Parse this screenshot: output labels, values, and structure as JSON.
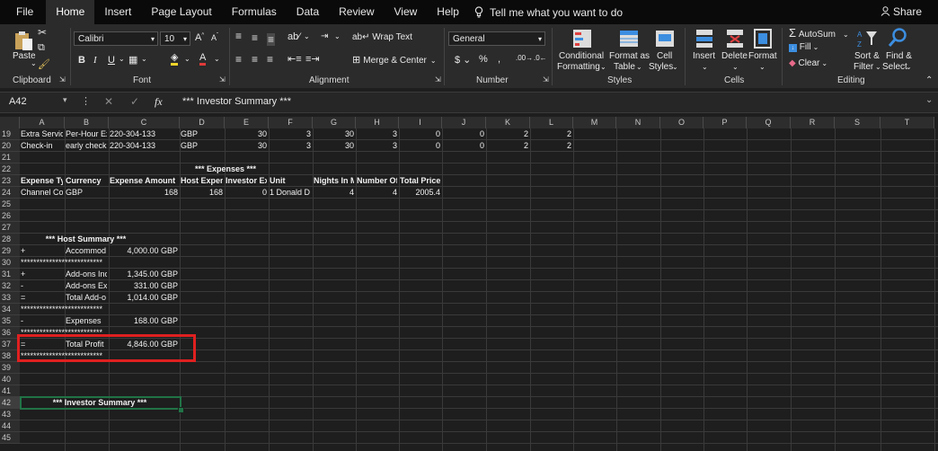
{
  "menu": {
    "file": "File",
    "home": "Home",
    "insert": "Insert",
    "page_layout": "Page Layout",
    "formulas": "Formulas",
    "data": "Data",
    "review": "Review",
    "view": "View",
    "help": "Help",
    "tell_me": "Tell me what you want to do",
    "share": "Share"
  },
  "ribbon": {
    "paste": "Paste",
    "clipboard": "Clipboard",
    "font_name": "Calibri",
    "font_size": "10",
    "font": "Font",
    "wrap_text": "Wrap Text",
    "merge_center": "Merge & Center",
    "alignment": "Alignment",
    "number_format": "General",
    "number": "Number",
    "conditional_formatting_1": "Conditional",
    "conditional_formatting_2": "Formatting",
    "format_as_table_1": "Format as",
    "format_as_table_2": "Table",
    "cell_styles_1": "Cell",
    "cell_styles_2": "Styles",
    "styles": "Styles",
    "insert": "Insert",
    "delete": "Delete",
    "format": "Format",
    "cells": "Cells",
    "autosum": "AutoSum",
    "fill": "Fill",
    "clear": "Clear",
    "sort_filter_1": "Sort &",
    "sort_filter_2": "Filter",
    "find_select_1": "Find &",
    "find_select_2": "Select",
    "editing": "Editing"
  },
  "formula_bar": {
    "name_box": "A42",
    "formula": "*** Investor Summary ***"
  },
  "columns": [
    "A",
    "B",
    "C",
    "D",
    "E",
    "F",
    "G",
    "H",
    "I",
    "J",
    "K",
    "L",
    "M",
    "N",
    "O",
    "P",
    "Q",
    "R",
    "S",
    "T"
  ],
  "rows": [
    "19",
    "20",
    "21",
    "22",
    "23",
    "24",
    "25",
    "26",
    "27",
    "28",
    "29",
    "30",
    "31",
    "32",
    "33",
    "34",
    "35",
    "36",
    "37",
    "38",
    "39",
    "40",
    "41",
    "42",
    "43",
    "44",
    "45"
  ],
  "selected_row": "42",
  "cells": {
    "r19": {
      "a": "Extra Servic",
      "b": "Per-Hour Ex",
      "c": "220-304-133",
      "d": "GBP",
      "e": "30",
      "f": "3",
      "g": "30",
      "h": "3",
      "i": "0",
      "j": "0",
      "k": "2",
      "l": "2"
    },
    "r20": {
      "a": "Check-in",
      "b": "early check",
      "c": "220-304-133",
      "d": "GBP",
      "e": "30",
      "f": "3",
      "g": "30",
      "h": "3",
      "i": "0",
      "j": "0",
      "k": "2",
      "l": "2"
    },
    "r22_expenses": "*** Expenses ***",
    "r23": {
      "a": "Expense Ty",
      "b": "Currency",
      "c": "Expense Amount",
      "d": "Host Expen",
      "e": "Investor Ex",
      "f": "Unit",
      "g": "Nights In M",
      "h": "Number Of",
      "i": "Total Price"
    },
    "r24": {
      "a": "Channel Co",
      "b": "GBP",
      "c": "168",
      "d": "168",
      "e": "0",
      "f": "1 Donald D",
      "g": "4",
      "h": "4",
      "i": "2005.4"
    },
    "r28_host": "*** Host Summary ***",
    "r29": {
      "a": "+",
      "b": "Accommod",
      "c": "4,000.00 GBP"
    },
    "stars": "**************************",
    "r31": {
      "a": "+",
      "b": "Add-ons Inc",
      "c": "1,345.00 GBP"
    },
    "r32": {
      "a": "-",
      "b": "Add-ons Ex",
      "c": "331.00 GBP"
    },
    "r33": {
      "a": "=",
      "b": "Total Add-o",
      "c": "1,014.00 GBP"
    },
    "r35": {
      "a": "-",
      "b": "Expenses",
      "c": "168.00 GBP"
    },
    "r37": {
      "a": "=",
      "b": "Total Profit",
      "c": "4,846.00 GBP"
    },
    "r42_investor": "*** Investor Summary ***"
  },
  "colors": {
    "excel_green": "#217346",
    "highlight_red": "#e02020",
    "autosum_blue": "#3c8ee0"
  }
}
